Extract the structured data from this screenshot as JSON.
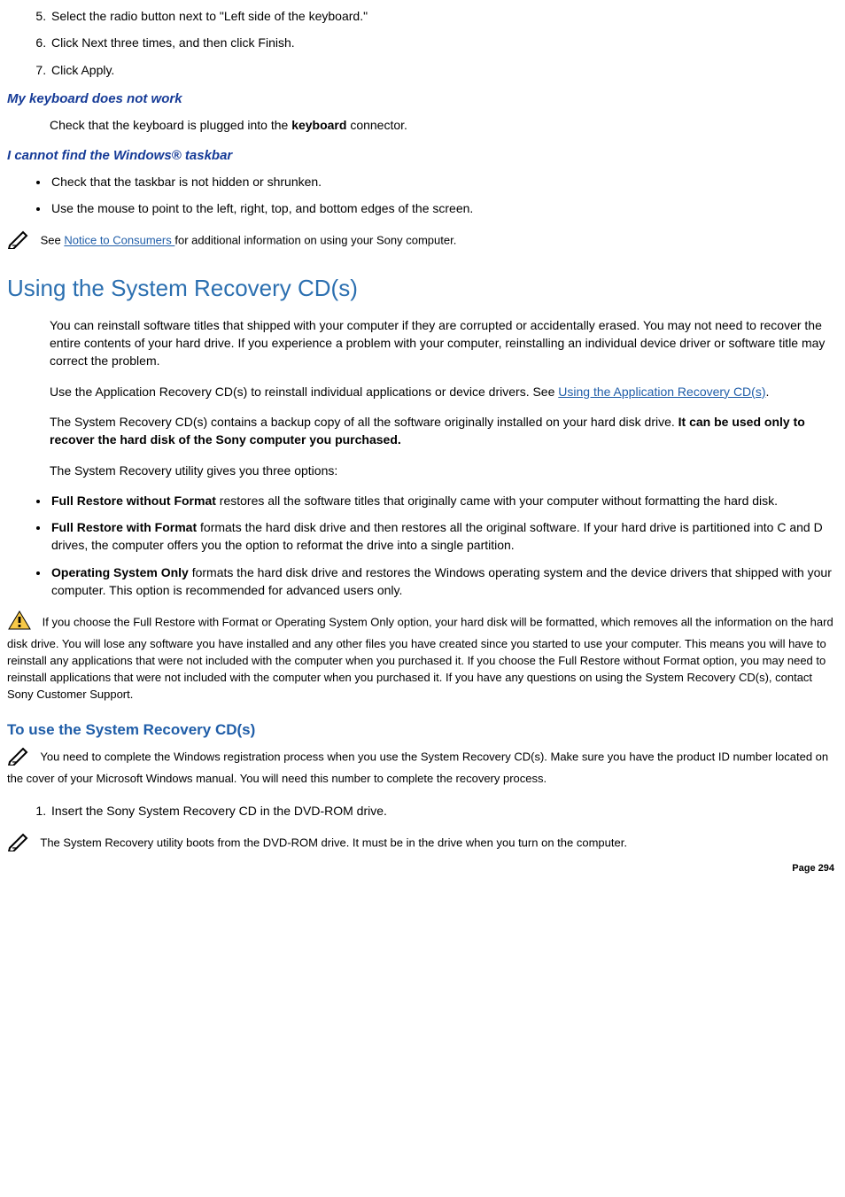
{
  "top_list": {
    "item5": "Select the radio button next to \"Left side of the keyboard.\"",
    "item6": "Click Next three times, and then click Finish.",
    "item7": "Click Apply."
  },
  "kbd_heading": "My keyboard does not work",
  "kbd_text_pre": "Check that the keyboard is plugged into the ",
  "kbd_text_strong": "keyboard",
  "kbd_text_post": " connector.",
  "taskbar_heading": "I cannot find the Windows® taskbar",
  "taskbar_items": {
    "a": "Check that the taskbar is not hidden or shrunken.",
    "b": "Use the mouse to point to the left, right, top, and bottom edges of the screen."
  },
  "note_see_pre": " See ",
  "note_see_link": "Notice to Consumers ",
  "note_see_post": "for additional information on using your Sony computer.",
  "section_title": "Using the System Recovery CD(s)",
  "para1": "You can reinstall software titles that shipped with your computer if they are corrupted or accidentally erased. You may not need to recover the entire contents of your hard drive. If you experience a problem with your computer, reinstalling an individual device driver or software title may correct the problem.",
  "para2_pre": "Use the Application Recovery CD(s) to reinstall individual applications or device drivers. See ",
  "para2_link": "Using the Application Recovery CD(s)",
  "para2_post": ".",
  "para3_pre": "The System Recovery CD(s) contains a backup copy of all the software originally installed on your hard disk drive. ",
  "para3_strong": "It can be used only to recover the hard disk of the Sony computer you purchased.",
  "para4": "The System Recovery utility gives you three options:",
  "opt1_strong": "Full Restore without Format",
  "opt1_rest": " restores all the software titles that originally came with your computer without formatting the hard disk.",
  "opt2_strong": "Full Restore with Format",
  "opt2_rest": " formats the hard disk drive and then restores all the original software. If your hard drive is partitioned into C and D drives, the computer offers you the option to reformat the drive into a single partition.",
  "opt3_strong": "Operating System Only",
  "opt3_rest": " formats the hard disk drive and restores the Windows operating system and the device drivers that shipped with your computer. This option is recommended for advanced users only.",
  "warn_text": " If you choose the Full Restore with Format or Operating System Only option, your hard disk will be formatted, which removes all the information on the hard disk drive. You will lose any software you have installed and any other files you have created since you started to use your computer. This means you will have to reinstall any applications that were not included with the computer when you purchased it. If you choose the Full Restore without Format option, you may need to reinstall applications that were not included with the computer when you purchased it. If you have any questions on using the System Recovery CD(s), contact Sony Customer Support.",
  "heading_use": "To use the System Recovery CD(s)",
  "note_reg": " You need to complete the Windows registration process when you use the System Recovery CD(s). Make sure you have the product ID number located on the cover of your Microsoft Windows manual. You will need this number to complete the recovery process.",
  "step1": "Insert the Sony System Recovery CD in the DVD-ROM drive.",
  "note_boot": " The System Recovery utility boots from the DVD-ROM drive. It must be in the drive when you turn on the computer.",
  "page_number": "Page 294"
}
